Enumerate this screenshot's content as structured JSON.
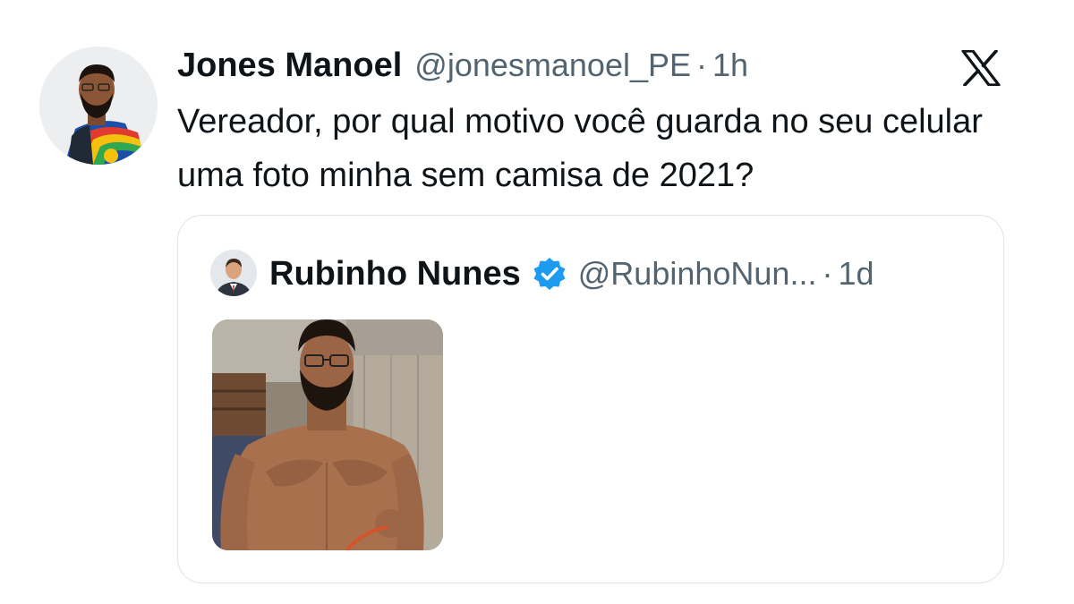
{
  "tweet": {
    "author_name": "Jones Manoel",
    "author_handle": "@jonesmanoel_PE",
    "separator": "·",
    "time": "1h",
    "text": "Vereador, por qual motivo você guarda no seu celular uma foto minha sem camisa de 2021?"
  },
  "quoted_tweet": {
    "author_name": "Rubinho Nunes",
    "verified": true,
    "author_handle": "@RubinhoNun...",
    "separator": "·",
    "time": "1d"
  },
  "icons": {
    "brand": "x-logo-icon",
    "verified": "verified-badge-icon"
  },
  "colors": {
    "text": "#0f1419",
    "secondary_text": "#536471",
    "verified_blue": "#1d9bf0",
    "card_border": "#dfe3e6"
  }
}
